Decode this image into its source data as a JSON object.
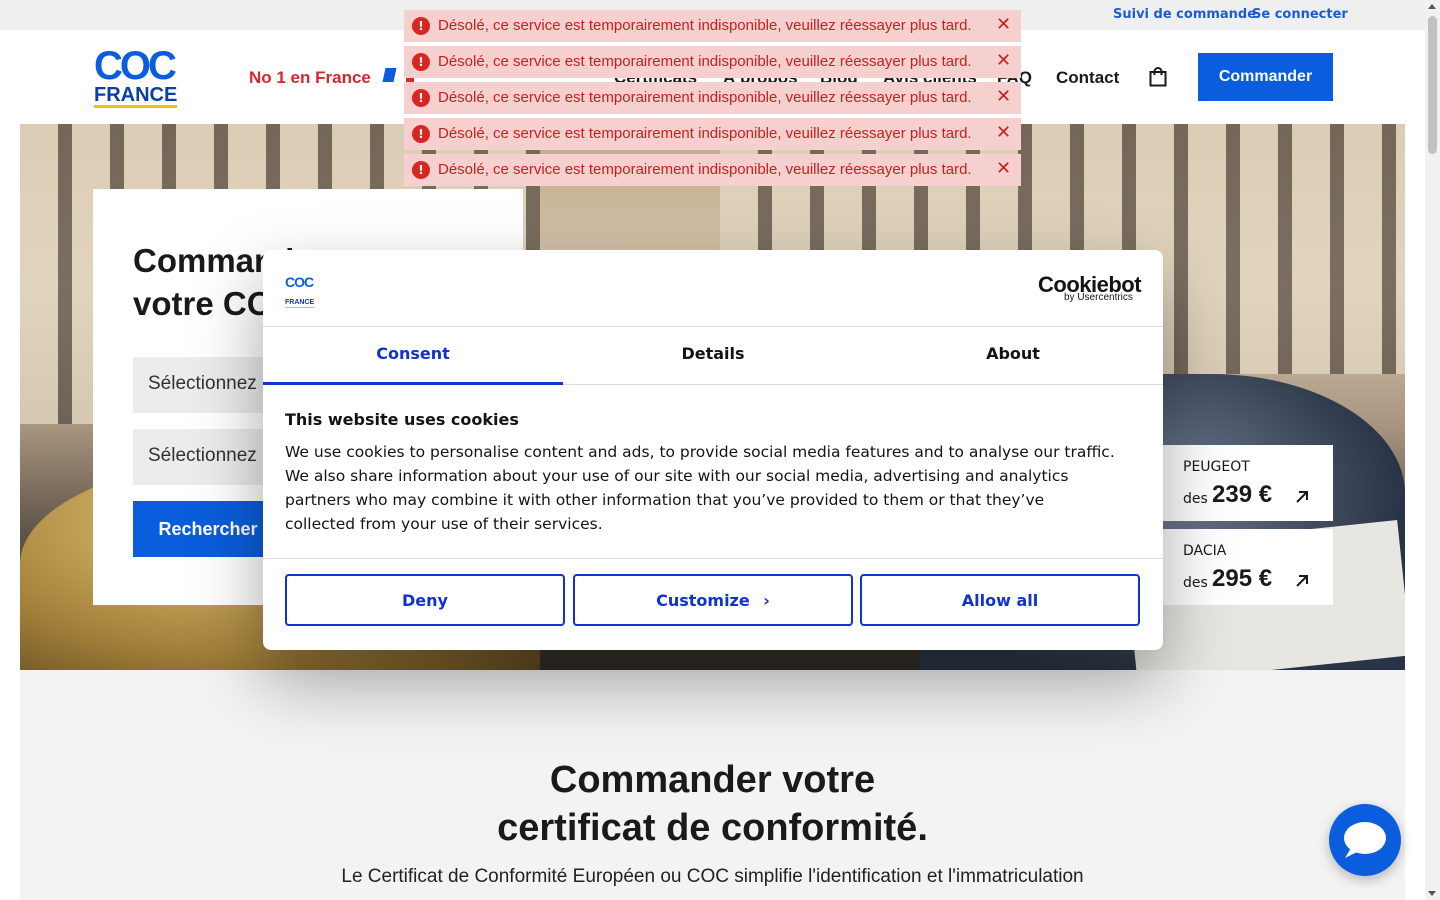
{
  "topbar": {
    "track_order": "Suivi de commande",
    "login": "Se connecter"
  },
  "header": {
    "logo": {
      "line1": "COC",
      "line2": "FRANCE"
    },
    "tagline": "No 1 en France",
    "nav": [
      "Certificats",
      "À propos",
      "Blog",
      "Avis clients",
      "FAQ",
      "Contact"
    ],
    "cta": "Commander"
  },
  "hero": {
    "title_line1": "Commander",
    "title_line2": "votre COC",
    "select_brand": "Sélectionnez la marque",
    "select_model": "Sélectionnez le modèle",
    "search": "Rechercher",
    "prices": [
      {
        "brand": "PEUGEOT",
        "prefix": "des",
        "amount": "239 €"
      },
      {
        "brand": "DACIA",
        "prefix": "des",
        "amount": "295 €"
      }
    ]
  },
  "section": {
    "title_line1": "Commander votre",
    "title_line2": "certificat de conformité.",
    "intro": "Le Certificat de Conformité Européen ou COC simplifie l'identification et l'immatriculation"
  },
  "toasts": {
    "message": "Désolé, ce service est temporairement indisponible, veuillez réessayer plus tard.",
    "items": [
      "Désolé, ce service est temporairement indisponible, veuillez réessayer plus tard.",
      "Désolé, ce service est temporairement indisponible, veuillez réessayer plus tard.",
      "Désolé, ce service est temporairement indisponible, veuillez réessayer plus tard.",
      "Désolé, ce service est temporairement indisponible, veuillez réessayer plus tard.",
      "Désolé, ce service est temporairement indisponible, veuillez réessayer plus tard."
    ]
  },
  "cookie": {
    "brand": "Cookiebot",
    "brand_sub": "by Usercentrics",
    "logo_line1": "COC",
    "logo_line2": "FRANCE",
    "tabs": [
      "Consent",
      "Details",
      "About"
    ],
    "title": "This website uses cookies",
    "body": "We use cookies to personalise content and ads, to provide social media features and to analyse our traffic. We also share information about your use of our site with our social media, advertising and analytics partners who may combine it with other information that you’ve provided to them or that they’ve collected from your use of their services.",
    "deny": "Deny",
    "customize": "Customize",
    "allow": "Allow all"
  },
  "colors": {
    "brand_blue": "#0a5ddc",
    "cookie_blue": "#1032cf",
    "toast_bg": "#f5d0cf",
    "toast_text": "#c4221f",
    "tagline_red": "#d7262f"
  },
  "icons": {
    "cart": "shopping-bag-icon",
    "toast": "error-icon",
    "close": "close-icon",
    "chat": "chat-icon",
    "arrow": "arrow-up-right-icon"
  }
}
